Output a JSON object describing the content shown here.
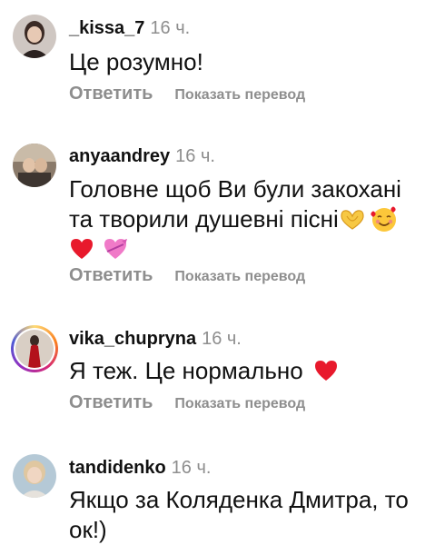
{
  "actions": {
    "reply_label": "Ответить",
    "translate_label": "Показать перевод"
  },
  "comments": [
    {
      "username": "_kissa_7",
      "time": "16 ч.",
      "text": "Це розумно!",
      "avatar_icon": "profile-photo"
    },
    {
      "username": "anyaandrey",
      "time": "16 ч.",
      "text_line1": "Головне щоб Ви були закохані",
      "text_line2": "та творили душевні пісні",
      "emojis": [
        "heart-hands-emoji",
        "smiling-face-with-hearts-emoji",
        "red-heart-emoji",
        "heart-with-ribbon-emoji"
      ],
      "avatar_icon": "profile-photo"
    },
    {
      "username": "vika_chupryna",
      "time": "16 ч.",
      "text": "Я теж. Це нормально",
      "emojis": [
        "red-heart-emoji"
      ],
      "avatar_icon": "profile-photo-story-ring"
    },
    {
      "username": "tandidenko",
      "time": "16 ч.",
      "text_line1": "Якщо за Коляденка Дмитра, то",
      "text_line2": "ок!)",
      "avatar_icon": "profile-photo"
    }
  ],
  "colors": {
    "text": "#111111",
    "secondary": "#8e8e8e",
    "heart": "#e8192c"
  }
}
